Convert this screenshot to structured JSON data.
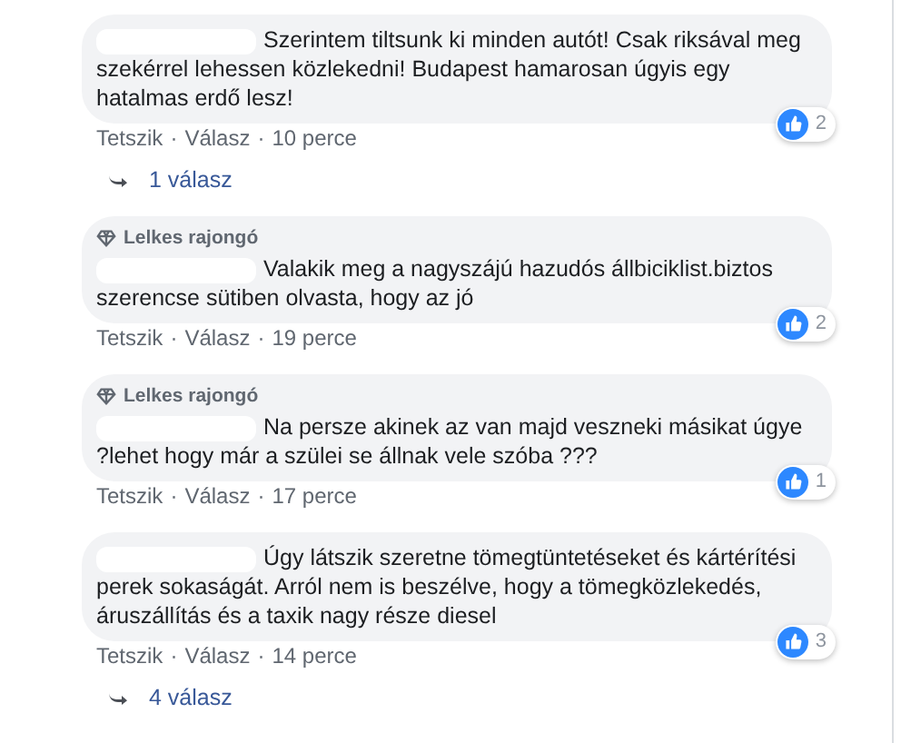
{
  "separator": "·",
  "comments": [
    {
      "text": "Szerintem tiltsunk ki minden autót! Csak riksával meg szekérrel lehessen közlekedni! Budapest hamarosan úgyis egy hatalmas erdő lesz!",
      "actions": [
        "Tetszik",
        "Válasz"
      ],
      "time": "10 perce",
      "likes": "2",
      "replies": "1 válasz"
    },
    {
      "badge": "Lelkes rajongó",
      "text": "Valakik meg a nagyszájú hazudós állbiciklist.biztos szerencse sütiben olvasta, hogy az jó",
      "actions": [
        "Tetszik",
        "Válasz"
      ],
      "time": "19 perce",
      "likes": "2"
    },
    {
      "badge": "Lelkes rajongó",
      "text": "Na persze akinek az van majd veszneki másikat úgye ?lehet hogy már a szülei se állnak vele szóba ???",
      "actions": [
        "Tetszik",
        "Válasz"
      ],
      "time": "17 perce",
      "likes": "1"
    },
    {
      "text": "Úgy látszik szeretne tömegtüntetéseket és kártérítési perek sokaságát. Arról nem is beszélve, hogy a tömegközlekedés, áruszállítás és a taxik nagy része diesel",
      "actions": [
        "Tetszik",
        "Válasz"
      ],
      "time": "14 perce",
      "likes": "3",
      "replies": "4 válasz"
    }
  ]
}
